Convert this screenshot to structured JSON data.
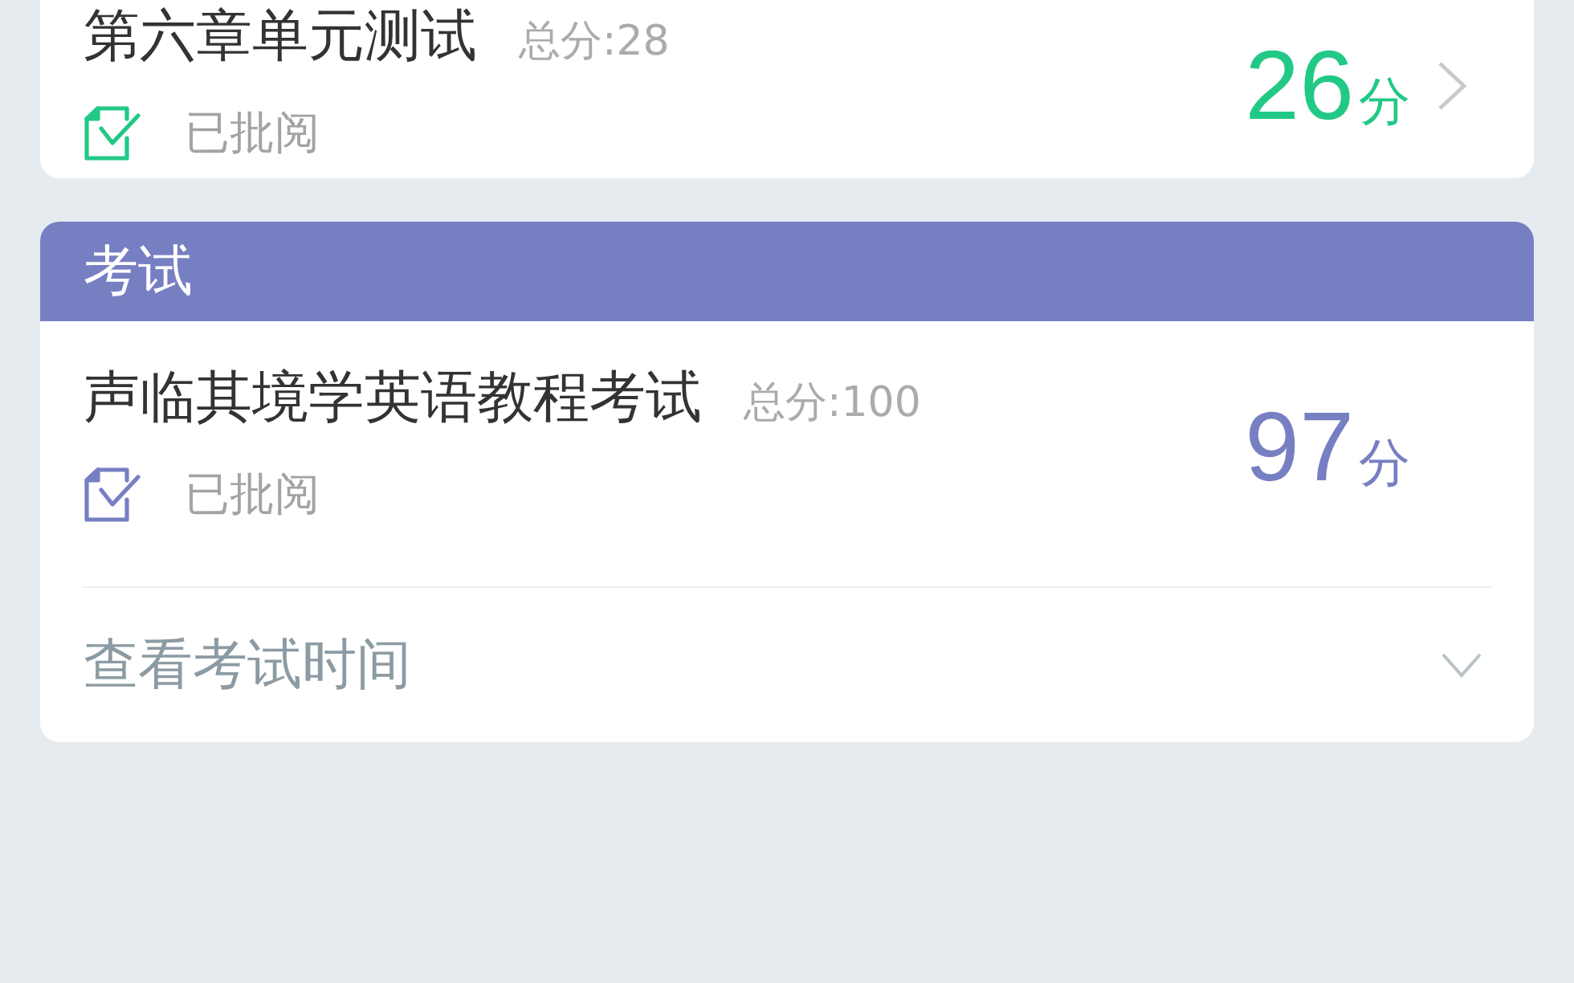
{
  "sections": [
    {
      "color": "#22c986",
      "items": [
        {
          "title": "第六章单元测试",
          "total": "总分:28",
          "status": "已批阅",
          "score": "26",
          "unit": "分",
          "openable": true
        }
      ]
    },
    {
      "header": "考试",
      "color": "#777fc3",
      "items": [
        {
          "title": "声临其境学英语教程考试",
          "total": "总分:100",
          "status": "已批阅",
          "score": "97",
          "unit": "分",
          "openable": false
        }
      ],
      "footer": {
        "label": "查看考试时间",
        "expanded": false
      }
    }
  ]
}
